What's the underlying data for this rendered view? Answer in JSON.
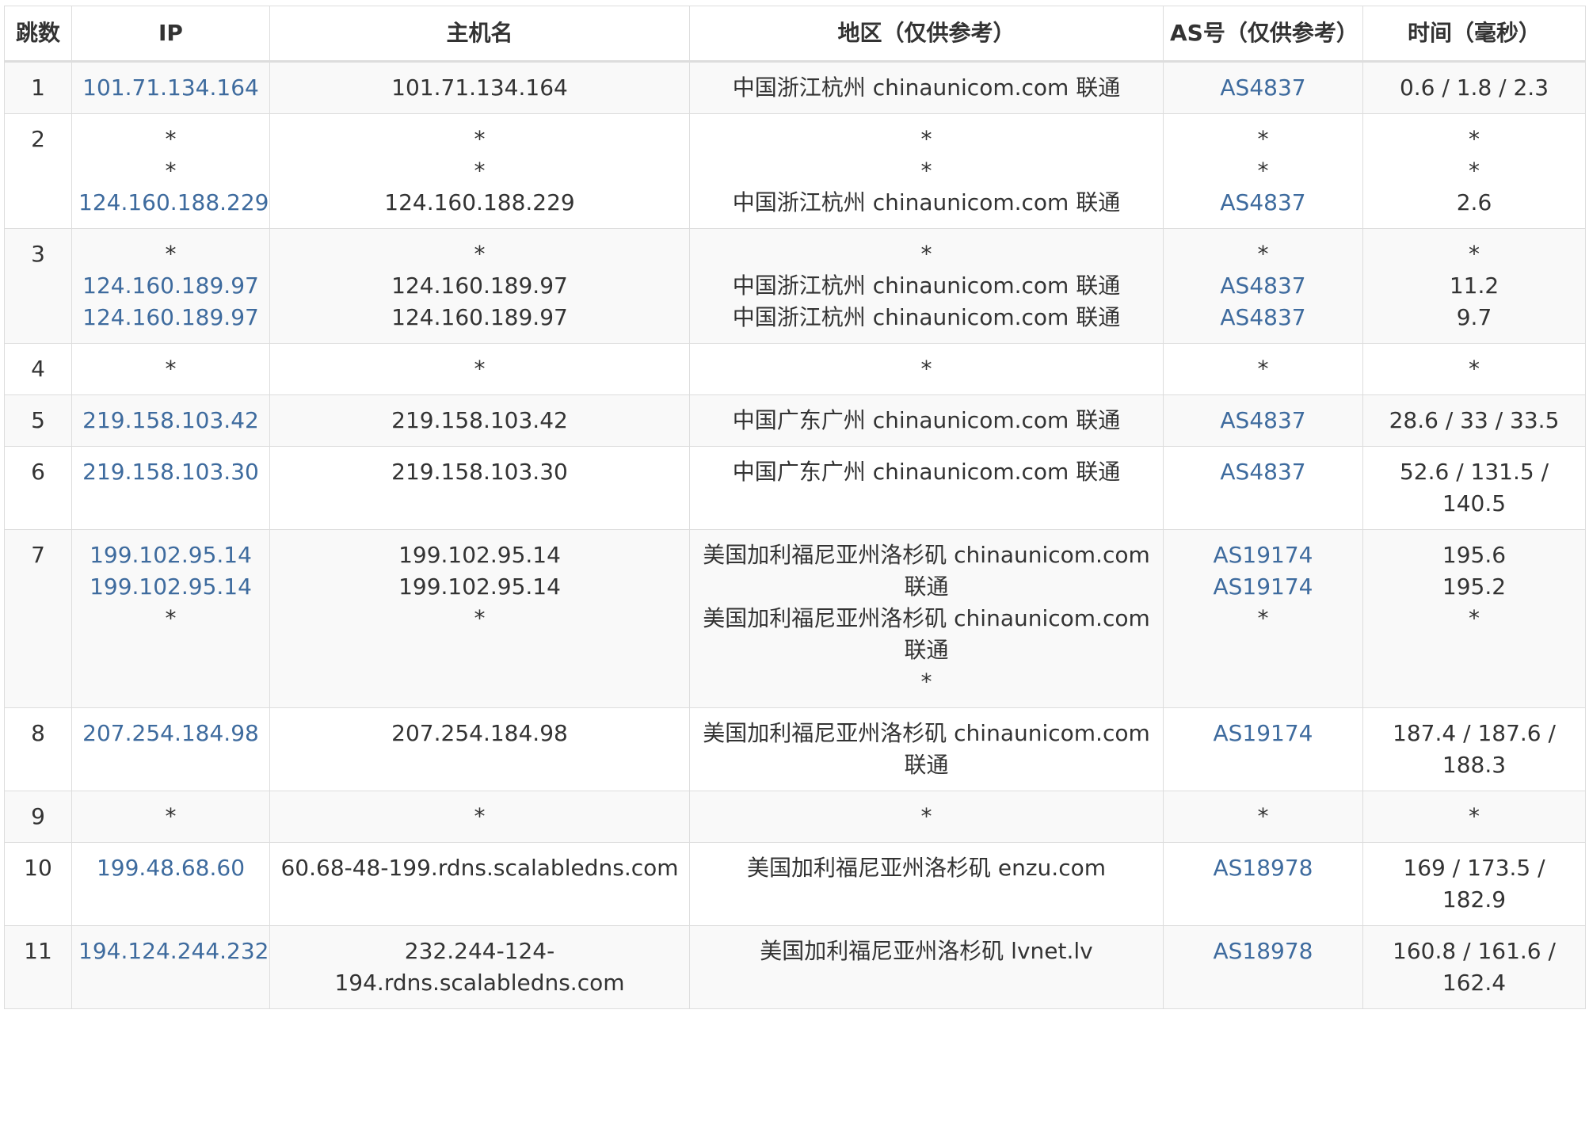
{
  "headers": {
    "hop": "跳数",
    "ip": "IP",
    "host": "主机名",
    "loc": "地区（仅供参考）",
    "as": "AS号（仅供参考）",
    "time": "时间（毫秒）"
  },
  "rows": [
    {
      "hop": "1",
      "ip": [
        "101.71.134.164"
      ],
      "host": [
        "101.71.134.164"
      ],
      "loc": [
        "中国浙江杭州 chinaunicom.com 联通"
      ],
      "as": [
        "AS4837"
      ],
      "time": [
        "0.6 / 1.8 / 2.3"
      ]
    },
    {
      "hop": "2",
      "ip": [
        "*",
        "*",
        "124.160.188.229"
      ],
      "host": [
        "*",
        "*",
        "124.160.188.229"
      ],
      "loc": [
        "*",
        "*",
        "中国浙江杭州 chinaunicom.com 联通"
      ],
      "as": [
        "*",
        "*",
        "AS4837"
      ],
      "time": [
        "*",
        "*",
        "2.6"
      ]
    },
    {
      "hop": "3",
      "ip": [
        "*",
        "124.160.189.97",
        "124.160.189.97"
      ],
      "host": [
        "*",
        "124.160.189.97",
        "124.160.189.97"
      ],
      "loc": [
        "*",
        "中国浙江杭州 chinaunicom.com 联通",
        "中国浙江杭州 chinaunicom.com 联通"
      ],
      "as": [
        "*",
        "AS4837",
        "AS4837"
      ],
      "time": [
        "*",
        "11.2",
        "9.7"
      ]
    },
    {
      "hop": "4",
      "ip": [
        "*"
      ],
      "host": [
        "*"
      ],
      "loc": [
        "*"
      ],
      "as": [
        "*"
      ],
      "time": [
        "*"
      ]
    },
    {
      "hop": "5",
      "ip": [
        "219.158.103.42"
      ],
      "host": [
        "219.158.103.42"
      ],
      "loc": [
        "中国广东广州 chinaunicom.com 联通"
      ],
      "as": [
        "AS4837"
      ],
      "time": [
        "28.6 / 33 / 33.5"
      ]
    },
    {
      "hop": "6",
      "ip": [
        "219.158.103.30"
      ],
      "host": [
        "219.158.103.30"
      ],
      "loc": [
        "中国广东广州 chinaunicom.com 联通"
      ],
      "as": [
        "AS4837"
      ],
      "time": [
        "52.6 / 131.5 / 140.5"
      ]
    },
    {
      "hop": "7",
      "ip": [
        "199.102.95.14",
        "199.102.95.14",
        "*"
      ],
      "host": [
        "199.102.95.14",
        "199.102.95.14",
        "*"
      ],
      "loc": [
        "美国加利福尼亚州洛杉矶 chinaunicom.com 联通",
        "美国加利福尼亚州洛杉矶 chinaunicom.com 联通",
        "*"
      ],
      "as": [
        "AS19174",
        "AS19174",
        "*"
      ],
      "time": [
        "195.6",
        "195.2",
        "*"
      ]
    },
    {
      "hop": "8",
      "ip": [
        "207.254.184.98"
      ],
      "host": [
        "207.254.184.98"
      ],
      "loc": [
        "美国加利福尼亚州洛杉矶 chinaunicom.com 联通"
      ],
      "as": [
        "AS19174"
      ],
      "time": [
        "187.4 / 187.6 / 188.3"
      ]
    },
    {
      "hop": "9",
      "ip": [
        "*"
      ],
      "host": [
        "*"
      ],
      "loc": [
        "*"
      ],
      "as": [
        "*"
      ],
      "time": [
        "*"
      ]
    },
    {
      "hop": "10",
      "ip": [
        "199.48.68.60"
      ],
      "host": [
        "60.68-48-199.rdns.scalabledns.com"
      ],
      "loc": [
        "美国加利福尼亚州洛杉矶 enzu.com"
      ],
      "as": [
        "AS18978"
      ],
      "time": [
        "169 / 173.5 / 182.9"
      ]
    },
    {
      "hop": "11",
      "ip": [
        "194.124.244.232"
      ],
      "host": [
        "232.244-124-194.rdns.scalabledns.com"
      ],
      "loc": [
        "美国加利福尼亚州洛杉矶 lvnet.lv"
      ],
      "as": [
        "AS18978"
      ],
      "time": [
        "160.8 / 161.6 / 162.4"
      ]
    }
  ],
  "colors": {
    "link": "#3e6b9e",
    "text": "#333333",
    "border": "#dddddd",
    "stripe": "#f9f9f9"
  }
}
